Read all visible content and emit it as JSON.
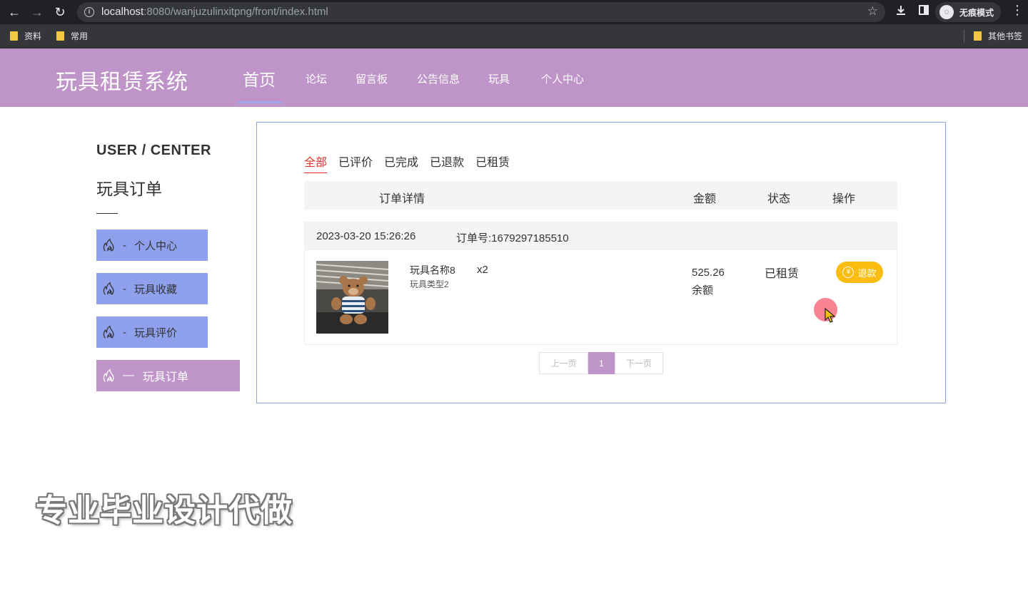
{
  "browser": {
    "url_host": "localhost",
    "url_path": ":8080/wanjuzulinxitpng/front/index.html",
    "profile_label": "无痕模式",
    "bookmarks": [
      "资料",
      "常用"
    ],
    "other_bookmarks": "其他书签",
    "icons": {
      "back": "back-arrow-icon",
      "forward": "forward-arrow-icon",
      "reload": "reload-icon",
      "star": "star-icon",
      "download": "download-icon",
      "sidepanel": "side-panel-icon",
      "menu": "kebab-menu-icon"
    }
  },
  "site": {
    "title": "玩具租赁系统",
    "nav": [
      "首页",
      "论坛",
      "留言板",
      "公告信息",
      "玩具",
      "个人中心"
    ],
    "active_nav": "首页"
  },
  "sidebar": {
    "heading": "USER / CENTER",
    "section_title": "玩具订单",
    "items": [
      {
        "label": "个人中心",
        "dash": "-"
      },
      {
        "label": "玩具收藏",
        "dash": "-"
      },
      {
        "label": "玩具评价",
        "dash": "-"
      },
      {
        "label": "玩具订单",
        "dash": "—"
      }
    ],
    "active_item": "玩具订单"
  },
  "orders": {
    "tabs": [
      "全部",
      "已评价",
      "已完成",
      "已退款",
      "已租赁"
    ],
    "active_tab": "全部",
    "columns": [
      "订单详情",
      "金额",
      "状态",
      "操作"
    ],
    "items": [
      {
        "date": "2023-03-20 15:26:26",
        "order_no": "订单号:1679297185510",
        "name": "玩具名称8",
        "type": "玩具类型2",
        "qty": "x2",
        "amount": "525.26",
        "pay_method": "余额",
        "status": "已租赁",
        "action": "退款"
      }
    ],
    "pagination": {
      "prev": "上一页",
      "current": "1",
      "next": "下一页"
    }
  },
  "watermark": "专业毕业设计代做",
  "colors": {
    "header_bg": "#bf95c9",
    "sidebar_btn": "#8fa1ec",
    "active_tab": "#e0342e",
    "refund_btn": "#fbbd0f"
  }
}
